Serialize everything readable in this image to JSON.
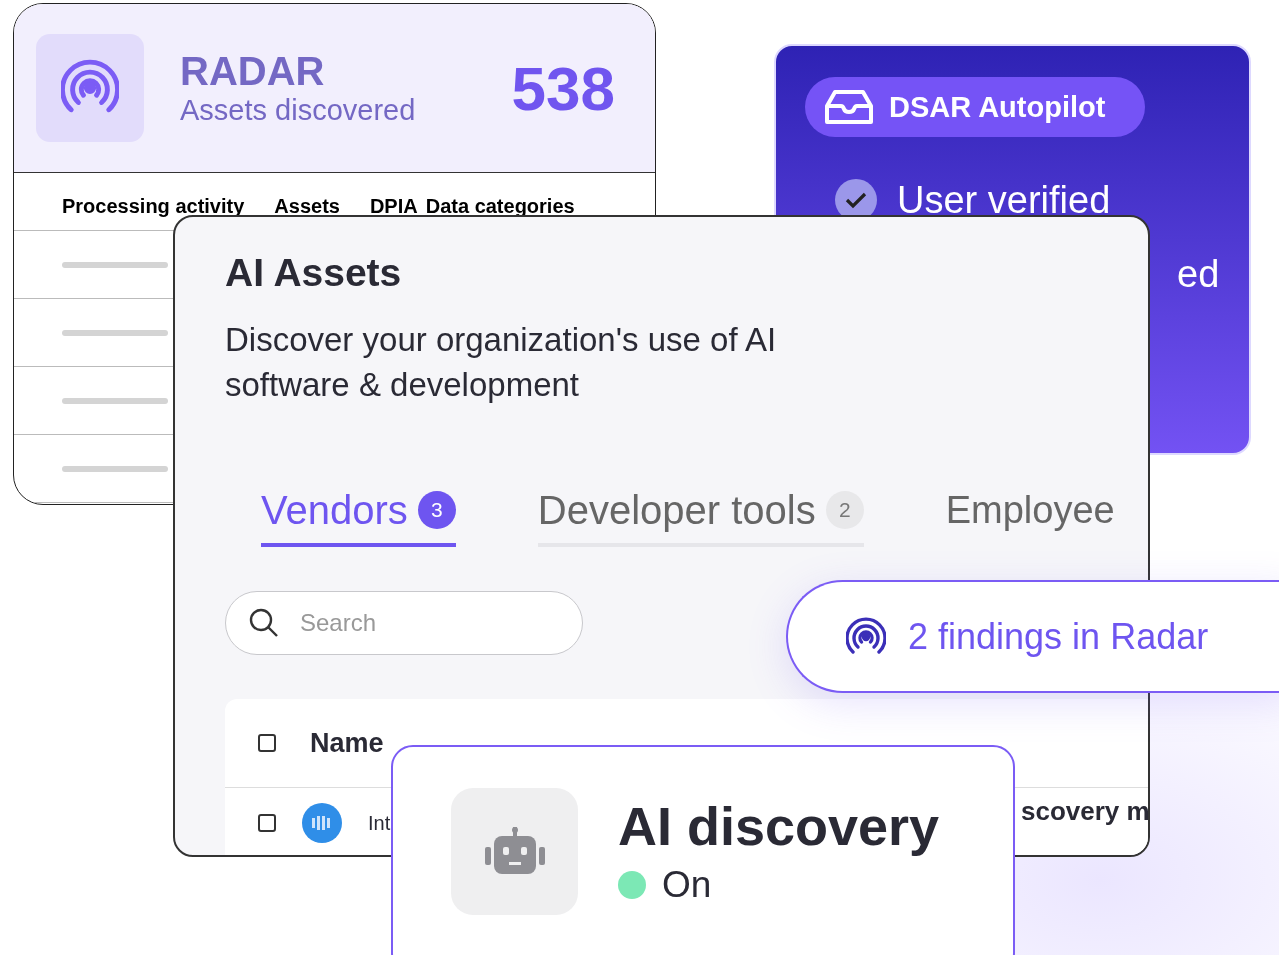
{
  "radar_card": {
    "title": "RADAR",
    "subtitle": "Assets discovered",
    "count": "538",
    "columns": [
      "Processing activity",
      "Assets",
      "DPIA",
      "Data categories"
    ],
    "rows": [
      {
        "kind": "skeleton"
      },
      {
        "kind": "skeleton"
      },
      {
        "kind": "skeleton"
      },
      {
        "kind": "skeleton"
      }
    ]
  },
  "dsar_card": {
    "title": "DSAR Autopilot",
    "steps": [
      {
        "label": "User verified",
        "done": true,
        "kind": "full"
      },
      {
        "label": "ed",
        "kind": "partial"
      }
    ]
  },
  "ai_assets": {
    "title": "AI Assets",
    "description": "Discover your organization's use of AI software & development",
    "tabs": [
      {
        "label": "Vendors",
        "count": "3",
        "selected": true
      },
      {
        "label": "Developer tools",
        "count": "2",
        "selected": false
      },
      {
        "label": "Employee",
        "selected": false
      }
    ],
    "search": {
      "placeholder": "Search"
    },
    "table": {
      "header_checked": false,
      "columns": [
        "Name"
      ],
      "rows": [
        {
          "name": "Int",
          "checked": false,
          "partial_text": "scovery m"
        }
      ]
    }
  },
  "findings_pill": {
    "text": "2 findings in Radar"
  },
  "ai_discovery": {
    "title": "AI discovery",
    "status": "On",
    "on": true
  }
}
